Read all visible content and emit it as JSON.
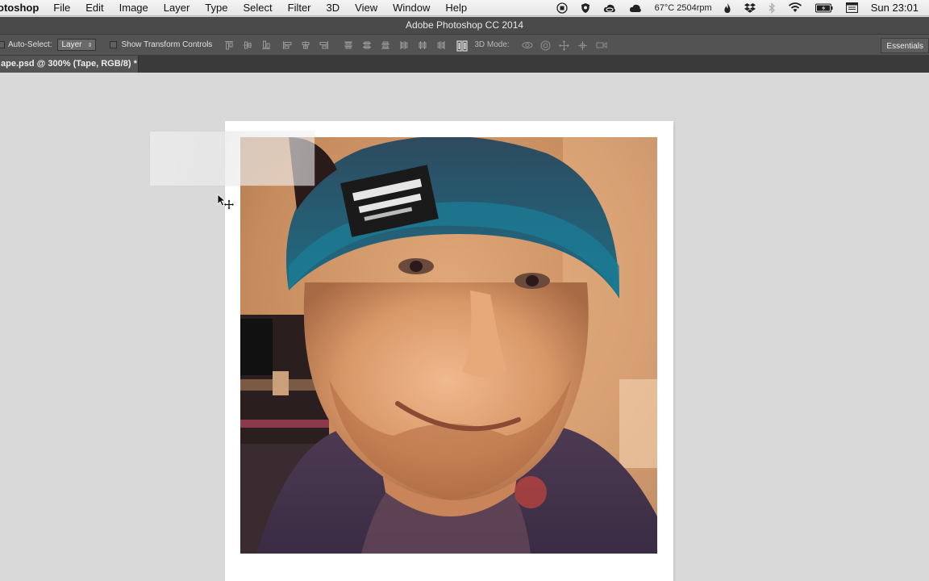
{
  "menubar": {
    "app_name": "otoshop",
    "items": [
      "File",
      "Edit",
      "Image",
      "Layer",
      "Type",
      "Select",
      "Filter",
      "3D",
      "View",
      "Window",
      "Help"
    ],
    "status": {
      "temperature": "67°C 2504rpm",
      "clock": "Sun 23:01",
      "icons": [
        "record-icon",
        "shield-icon",
        "creative-cloud-icon",
        "cloud-icon",
        "flame-icon",
        "dropbox-icon",
        "bluetooth-icon",
        "wifi-icon",
        "battery-icon",
        "display-icon"
      ]
    }
  },
  "window": {
    "title": "Adobe Photoshop CC 2014"
  },
  "options_bar": {
    "auto_select_label": "Auto-Select:",
    "auto_select_value": "Layer",
    "show_transform_label": "Show Transform Controls",
    "mode_3d_label": "3D Mode:",
    "workspace_button": "Essentials"
  },
  "document": {
    "tab_label": "ape.psd @ 300% (Tape, RGB/8) *"
  },
  "colors": {
    "menubar_bg": "#ececec",
    "titlebar_bg": "#4a4a4a",
    "optionsbar_bg": "#535353",
    "tabbar_bg": "#3a3a3a",
    "canvas_bg": "#d9d9d9",
    "frame_bg": "#ffffff"
  }
}
